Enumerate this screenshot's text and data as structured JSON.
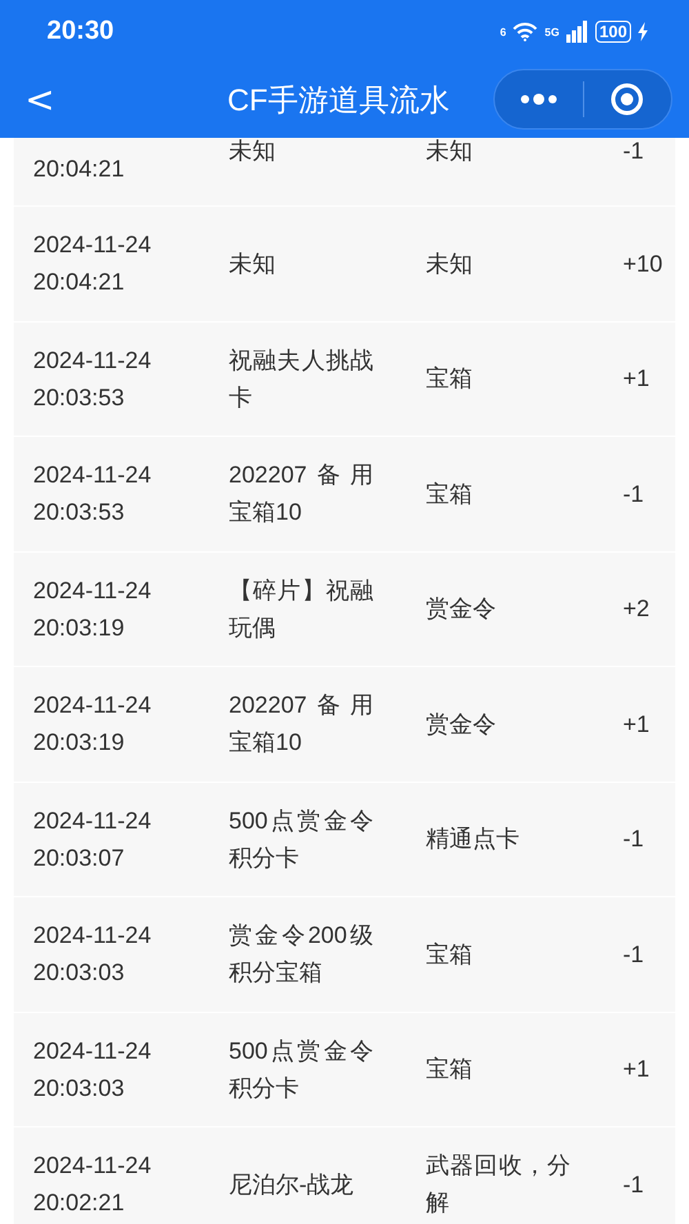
{
  "status_bar": {
    "time": "20:30",
    "wifi_label": "6",
    "network": "5G",
    "battery": "100"
  },
  "nav": {
    "back": "<",
    "title": "CF手游道具流水"
  },
  "rows": [
    {
      "kind": "partial",
      "time": "20:04:21",
      "item": "未知",
      "type": "未知",
      "change": "-1"
    },
    {
      "kind": "full",
      "date": "2024-11-24",
      "time": "20:04:21",
      "item": "未知",
      "type": "未知",
      "change": "+10"
    },
    {
      "kind": "full",
      "date": "2024-11-24",
      "time": "20:03:53",
      "item": "祝融夫人挑战卡",
      "type": "宝箱",
      "change": "+1"
    },
    {
      "kind": "full",
      "date": "2024-11-24",
      "time": "20:03:53",
      "item": "202207备用宝箱10",
      "type": "宝箱",
      "change": "-1"
    },
    {
      "kind": "full",
      "date": "2024-11-24",
      "time": "20:03:19",
      "item": "【碎片】祝融玩偶",
      "type": "赏金令",
      "change": "+2"
    },
    {
      "kind": "full",
      "date": "2024-11-24",
      "time": "20:03:19",
      "item": "202207备用宝箱10",
      "type": "赏金令",
      "change": "+1"
    },
    {
      "kind": "full",
      "date": "2024-11-24",
      "time": "20:03:07",
      "item": "500点赏金令积分卡",
      "type": "精通点卡",
      "change": "-1"
    },
    {
      "kind": "full",
      "date": "2024-11-24",
      "time": "20:03:03",
      "item": "赏金令200级积分宝箱",
      "type": "宝箱",
      "change": "-1"
    },
    {
      "kind": "full",
      "date": "2024-11-24",
      "time": "20:03:03",
      "item": "500点赏金令积分卡",
      "type": "宝箱",
      "change": "+1"
    },
    {
      "kind": "full",
      "date": "2024-11-24",
      "time": "20:02:21",
      "item": "尼泊尔-战龙",
      "type": "武器回收，分解",
      "change": "-1"
    }
  ]
}
